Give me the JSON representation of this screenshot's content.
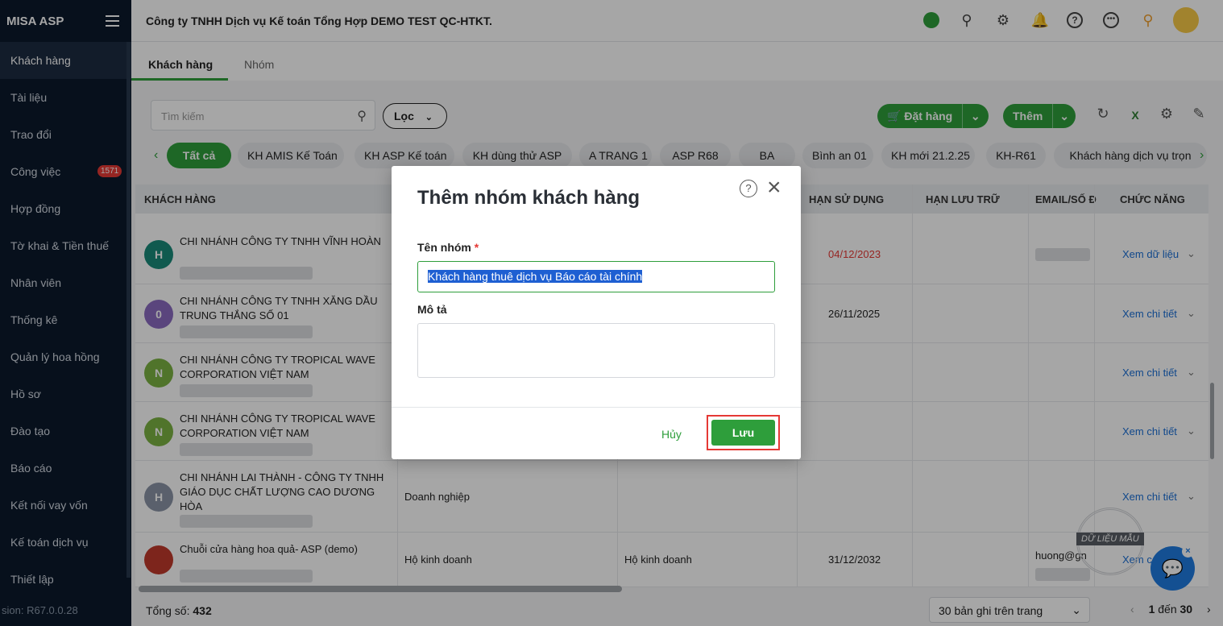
{
  "app": {
    "brand": "MISA ASP",
    "version": "sion: R67.0.0.28"
  },
  "sidebar": {
    "items": [
      {
        "label": "Khách hàng",
        "active": true
      },
      {
        "label": "Tài liệu"
      },
      {
        "label": "Trao đổi"
      },
      {
        "label": "Công việc",
        "badge": "1571"
      },
      {
        "label": "Hợp đồng"
      },
      {
        "label": "Tờ khai & Tiền thuế"
      },
      {
        "label": "Nhân viên"
      },
      {
        "label": "Thống kê"
      },
      {
        "label": "Quản lý hoa hồng"
      },
      {
        "label": "Hồ sơ"
      },
      {
        "label": "Đào tạo"
      },
      {
        "label": "Báo cáo"
      },
      {
        "label": "Kết nối vay vốn"
      },
      {
        "label": "Kế toán dịch vụ"
      },
      {
        "label": "Thiết lập"
      }
    ]
  },
  "header": {
    "company": "Công ty TNHH Dịch vụ Kế toán Tổng Hợp DEMO TEST QC-HTKT."
  },
  "tabs": [
    {
      "label": "Khách hàng"
    },
    {
      "label": "Nhóm"
    }
  ],
  "toolbar": {
    "search_placeholder": "Tìm kiếm",
    "filter_label": "Lọc",
    "order_label": "Đặt hàng",
    "add_label": "Thêm"
  },
  "chips": [
    "Tất cả",
    "KH AMIS Kế Toán",
    "KH ASP Kế toán",
    "KH dùng thử ASP",
    "A TRANG 1",
    "ASP R68",
    "BA",
    "Bình an 01",
    "KH mới 21.2.25",
    "KH-R61",
    "Khách hàng dịch vụ trọn"
  ],
  "table": {
    "headers": [
      "KHÁCH HÀNG",
      "HẠN SỬ DỤNG",
      "HẠN LƯU TRỮ",
      "EMAIL/SỐ Đ",
      "CHỨC NĂNG"
    ],
    "rows": [
      {
        "initial": "H",
        "name": "CHI NHÁNH CÔNG TY TNHH VĨNH HOÀN",
        "type": "",
        "type2": "",
        "expiry": "04/12/2023",
        "email": "",
        "action": "Xem dữ liệu"
      },
      {
        "initial": "0",
        "name": "CHI NHÁNH CÔNG TY TNHH XĂNG DẦU TRUNG THẮNG SỐ 01",
        "type": "",
        "type2": "",
        "expiry": "26/11/2025",
        "email": "",
        "action": "Xem chi tiết"
      },
      {
        "initial": "N",
        "name": "CHI NHÁNH CÔNG TY TROPICAL WAVE CORPORATION VIỆT NAM",
        "type": "",
        "type2": "",
        "expiry": "",
        "email": "",
        "action": "Xem chi tiết"
      },
      {
        "initial": "N",
        "name": "CHI NHÁNH CÔNG TY TROPICAL WAVE CORPORATION VIỆT NAM",
        "type": "",
        "type2": "",
        "expiry": "",
        "email": "",
        "action": "Xem chi tiết"
      },
      {
        "initial": "H",
        "name": "CHI NHÁNH LAI THÀNH - CÔNG TY TNHH GIÁO DỤC CHẤT LƯỢNG CAO DƯƠNG HÒA",
        "type": "Doanh nghiệp",
        "type2": "",
        "expiry": "",
        "email": "",
        "action": "Xem chi tiết"
      },
      {
        "initial": "",
        "name": "Chuỗi cửa hàng hoa quả- ASP (demo)",
        "type": "Hộ kinh doanh",
        "type2": "Hộ kinh doanh",
        "expiry": "31/12/2032",
        "email": "huong@gn",
        "action": "Xem c"
      }
    ]
  },
  "footer": {
    "total_label": "Tổng số:",
    "total": "432",
    "page_size": "30 bản ghi trên trang",
    "page_start": "1",
    "page_to": "đến",
    "page_end": "30"
  },
  "modal": {
    "title": "Thêm nhóm khách hàng",
    "name_label": "Tên nhóm",
    "required_mark": "*",
    "name_value": "Khách hàng thuê dịch vụ Báo cáo tài chính",
    "desc_label": "Mô tả",
    "desc_value": "",
    "cancel": "Hủy",
    "save": "Lưu"
  },
  "stamp": "DỮ LIỆU MẪU",
  "colors": {
    "accent": "#2e9e3b",
    "sidebar": "#0b1a2c",
    "link": "#1b6fd6",
    "danger": "#e53935"
  }
}
